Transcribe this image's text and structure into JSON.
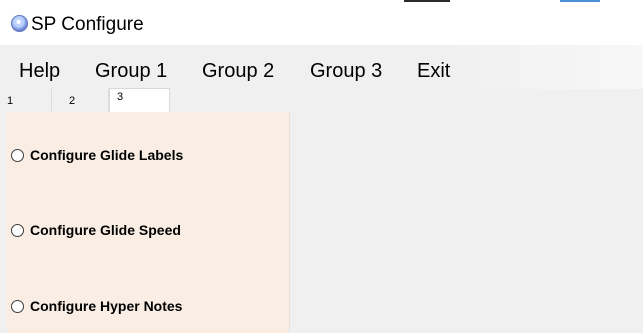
{
  "window": {
    "title": "SP Configure",
    "icon": "app-disc-icon"
  },
  "menubar": {
    "items": [
      "Help",
      "Group 1",
      "Group 2",
      "Group 3",
      "Exit"
    ]
  },
  "tabs": {
    "labels": [
      "1",
      "2",
      "3"
    ],
    "selected": "3"
  },
  "panel": {
    "background": "#faeee4",
    "options": [
      {
        "label": "Configure Glide Labels",
        "checked": false
      },
      {
        "label": "Configure Glide Speed",
        "checked": false
      },
      {
        "label": "Configure Hyper Notes",
        "checked": false
      }
    ]
  }
}
